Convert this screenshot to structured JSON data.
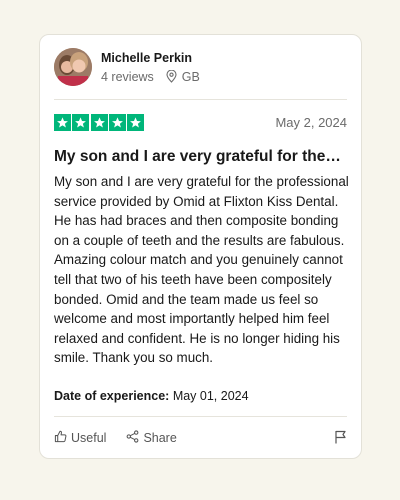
{
  "reviewer": {
    "name": "Michelle Perkin",
    "reviews_count": "4 reviews",
    "location": "GB",
    "avatar_icon": "profile-photo"
  },
  "review": {
    "rating": 5,
    "rating_max": 5,
    "star_color": "#00b67a",
    "date": "May 2, 2024",
    "title": "My son and I are very grateful for the…",
    "body": "My son and I are very grateful for the professional service provided by Omid at Flixton Kiss Dental. He has had braces and then composite bonding on a couple of teeth and the results are fabulous. Amazing colour match and you genuinely cannot tell that two of his teeth have been compositely bonded. Omid and the team made us feel so welcome and most importantly helped him feel relaxed and confident. He is no longer hiding his smile. Thank you so much.",
    "experience_label": "Date of experience:",
    "experience_date": "May 01, 2024"
  },
  "actions": {
    "useful_label": "Useful",
    "share_label": "Share",
    "useful_icon": "thumbs-up-icon",
    "share_icon": "share-icon",
    "flag_icon": "flag-icon"
  }
}
